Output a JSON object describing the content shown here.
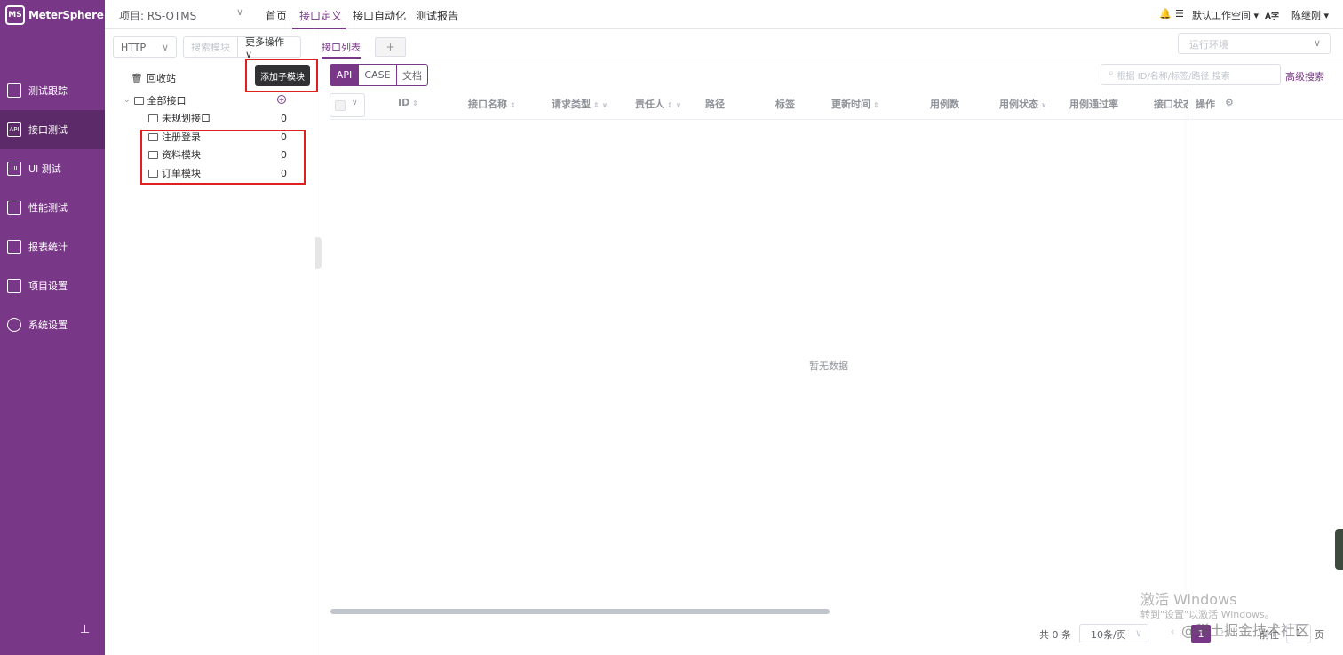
{
  "app": {
    "name": "MeterSphere",
    "logo_mark": "MS"
  },
  "sidebar": {
    "items": [
      {
        "label": "测试跟踪",
        "icon": "clipboard-icon"
      },
      {
        "label": "接口测试",
        "icon": "api-icon",
        "icon_text": "API"
      },
      {
        "label": "UI 测试",
        "icon": "ui-icon",
        "icon_text": "UI"
      },
      {
        "label": "性能测试",
        "icon": "chart-icon"
      },
      {
        "label": "报表统计",
        "icon": "report-icon"
      },
      {
        "label": "项目设置",
        "icon": "folder-icon"
      },
      {
        "label": "系统设置",
        "icon": "gear-icon"
      }
    ],
    "pin_icon": "⊥"
  },
  "topbar": {
    "project": "项目: RS-OTMS",
    "project_arrow": "∨",
    "tabs": [
      "首页",
      "接口定义",
      "接口自动化",
      "测试报告"
    ],
    "workspace": "默认工作空间 ▾",
    "user": "陈继刚 ▾",
    "lang": "A字",
    "bell_icon": "🔔",
    "list_icon": "☰"
  },
  "tree": {
    "protocol": "HTTP",
    "protocol_arrow": "∨",
    "search_placeholder": "搜索模块",
    "more_ops": "更多操作 ∨",
    "recycle": "回收站",
    "recycle_icon": "🗑",
    "tooltip": "添加子模块",
    "root": "全部接口",
    "root_arrow": "⌄",
    "add_icon": "+",
    "nodes": [
      {
        "label": "未规划接口",
        "count": "0"
      },
      {
        "label": "注册登录",
        "count": "0"
      },
      {
        "label": "资料模块",
        "count": "0"
      },
      {
        "label": "订单模块",
        "count": "0"
      }
    ]
  },
  "main": {
    "tab": "接口列表",
    "add_tab": "+",
    "env_placeholder": "运行环境",
    "env_arrow": "∨",
    "modes": [
      "API",
      "CASE",
      "文档"
    ],
    "search_placeholder": "根据 ID/名称/标签/路径 搜索",
    "search_icon": "⌕",
    "advanced_search": "高级搜索",
    "select_arrow": "∨",
    "columns": [
      "ID",
      "接口名称",
      "请求类型",
      "责任人",
      "路径",
      "标签",
      "更新时间",
      "用例数",
      "用例状态",
      "用例通过率",
      "接口状态",
      "操作"
    ],
    "sort_icon": "⇕",
    "filter_icon": "∨",
    "settings_icon": "⚙",
    "empty": "暂无数据",
    "total": "共 0 条",
    "page_size": "10条/页",
    "page_size_arrow": "∨",
    "prev_icon": "‹",
    "next_icon": "›",
    "page": "1",
    "goto_label": "前往",
    "goto_value": "1",
    "page_suffix": "页"
  },
  "watermark": {
    "line1": "激活 Windows",
    "line2": "转到\"设置\"以激活 Windows。",
    "line3": "@稀土掘金技术社区"
  }
}
